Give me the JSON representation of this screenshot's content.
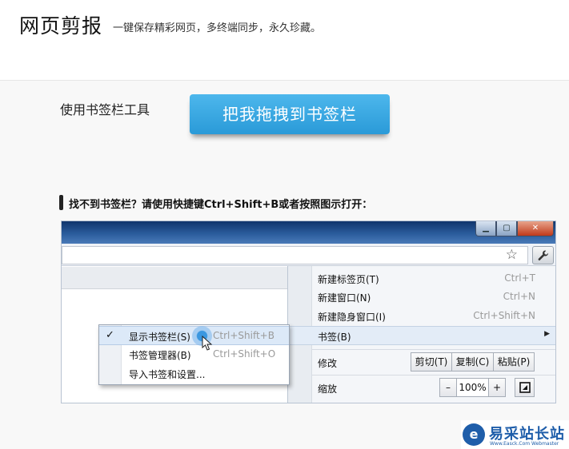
{
  "header": {
    "title": "网页剪报",
    "subtitle": "一键保存精彩网页，多终端同步，永久珍藏。"
  },
  "tool": {
    "label": "使用书签栏工具",
    "drag_button": "把我拖拽到书签栏"
  },
  "hint": {
    "text": "找不到书签栏？请使用快捷键Ctrl+Shift+B或者按照图示打开："
  },
  "browser": {
    "window_controls": {
      "minimize": "▁",
      "maximize": "▢",
      "close": "✕"
    },
    "menu": {
      "items": [
        {
          "label": "新建标签页(T)",
          "shortcut": "Ctrl+T"
        },
        {
          "label": "新建窗口(N)",
          "shortcut": "Ctrl+N"
        },
        {
          "label": "新建隐身窗口(I)",
          "shortcut": "Ctrl+Shift+N"
        },
        {
          "label": "书签(B)",
          "arrow": "▶"
        }
      ],
      "edit": {
        "label": "修改",
        "cut": "剪切(T)",
        "copy": "复制(C)",
        "paste": "粘贴(P)"
      },
      "zoom": {
        "label": "缩放",
        "minus": "–",
        "value": "100%",
        "plus": "+"
      }
    },
    "bookmarks_submenu": {
      "items": [
        {
          "label": "显示书签栏(S)",
          "shortcut": "Ctrl+Shift+B",
          "checked": true,
          "check": "✓"
        },
        {
          "label": "书签管理器(B)",
          "shortcut": "Ctrl+Shift+O"
        },
        {
          "label": "导入书签和设置..."
        }
      ]
    }
  },
  "watermark": {
    "logo": "e",
    "text": "易采站长站",
    "url": "Www.Easck.Com Webmaster"
  },
  "colors": {
    "accent_button": "#2a9ad8",
    "titlebar": "#10356c",
    "watermark": "#1f5eaa"
  }
}
